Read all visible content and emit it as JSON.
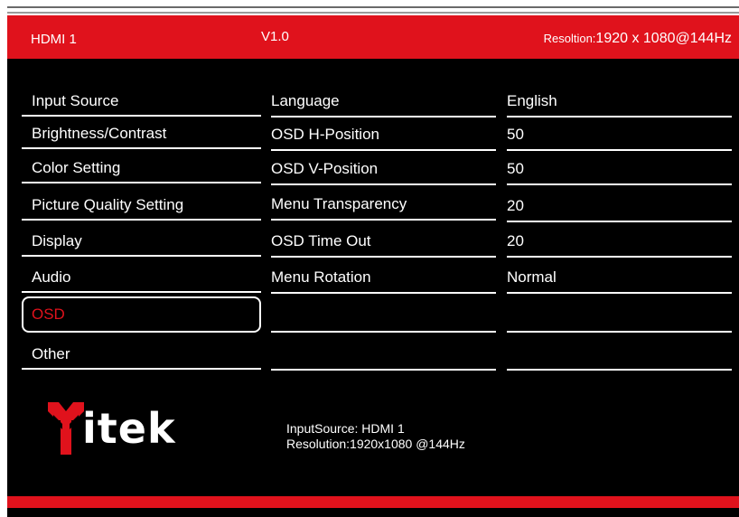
{
  "header": {
    "input_source": "HDMI 1",
    "version": "V1.0",
    "resolution_label": "Resoltion:",
    "resolution_value": "1920 x 1080@144Hz"
  },
  "menu": {
    "items": [
      {
        "label": "Input Source",
        "selected": false
      },
      {
        "label": "Brightness/Contrast",
        "selected": false
      },
      {
        "label": "Color Setting",
        "selected": false
      },
      {
        "label": "Picture Quality Setting",
        "selected": false
      },
      {
        "label": "Display",
        "selected": false
      },
      {
        "label": "Audio",
        "selected": false
      },
      {
        "label": "OSD",
        "selected": true
      },
      {
        "label": "Other",
        "selected": false
      }
    ]
  },
  "settings": {
    "rows": [
      {
        "label": "Language",
        "value": "English"
      },
      {
        "label": "OSD H-Position",
        "value": "50"
      },
      {
        "label": "OSD V-Position",
        "value": "50"
      },
      {
        "label": "Menu Transparency",
        "value": "20"
      },
      {
        "label": "OSD Time Out",
        "value": "20"
      },
      {
        "label": "Menu Rotation",
        "value": "Normal"
      },
      {
        "label": "",
        "value": ""
      },
      {
        "label": "",
        "value": ""
      }
    ]
  },
  "logo": {
    "text": "itek"
  },
  "info": {
    "line1": "InputSource: HDMI 1",
    "line2": "Resolution:1920x1080 @144Hz"
  },
  "colors": {
    "accent_red": "#e0121c",
    "background": "#000000",
    "text": "#ffffff"
  }
}
